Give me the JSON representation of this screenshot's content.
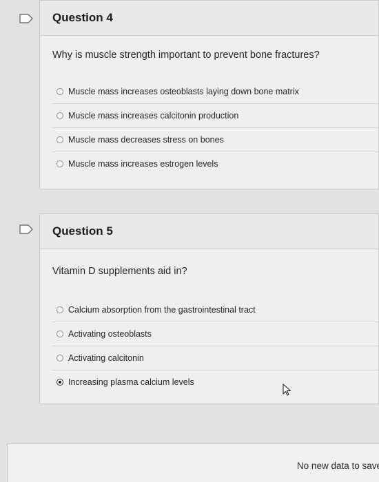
{
  "questions": [
    {
      "title": "Question 4",
      "prompt": "Why is muscle strength important to prevent bone fractures?",
      "options": [
        "Muscle mass increases osteoblasts laying down bone matrix",
        "Muscle mass increases calcitonin production",
        "Muscle mass decreases stress on bones",
        "Muscle mass increases estrogen levels"
      ],
      "selected_index": null
    },
    {
      "title": "Question 5",
      "prompt": "Vitamin D supplements aid in?",
      "options": [
        "Calcium absorption from the gastrointestinal tract",
        "Activating osteoblasts",
        "Activating calcitonin",
        "Increasing plasma calcium levels"
      ],
      "selected_index": 3
    }
  ],
  "footer": {
    "status_text": "No new data to save"
  },
  "icons": {
    "flag": "flag-icon",
    "cursor": "mouse-pointer-icon"
  }
}
